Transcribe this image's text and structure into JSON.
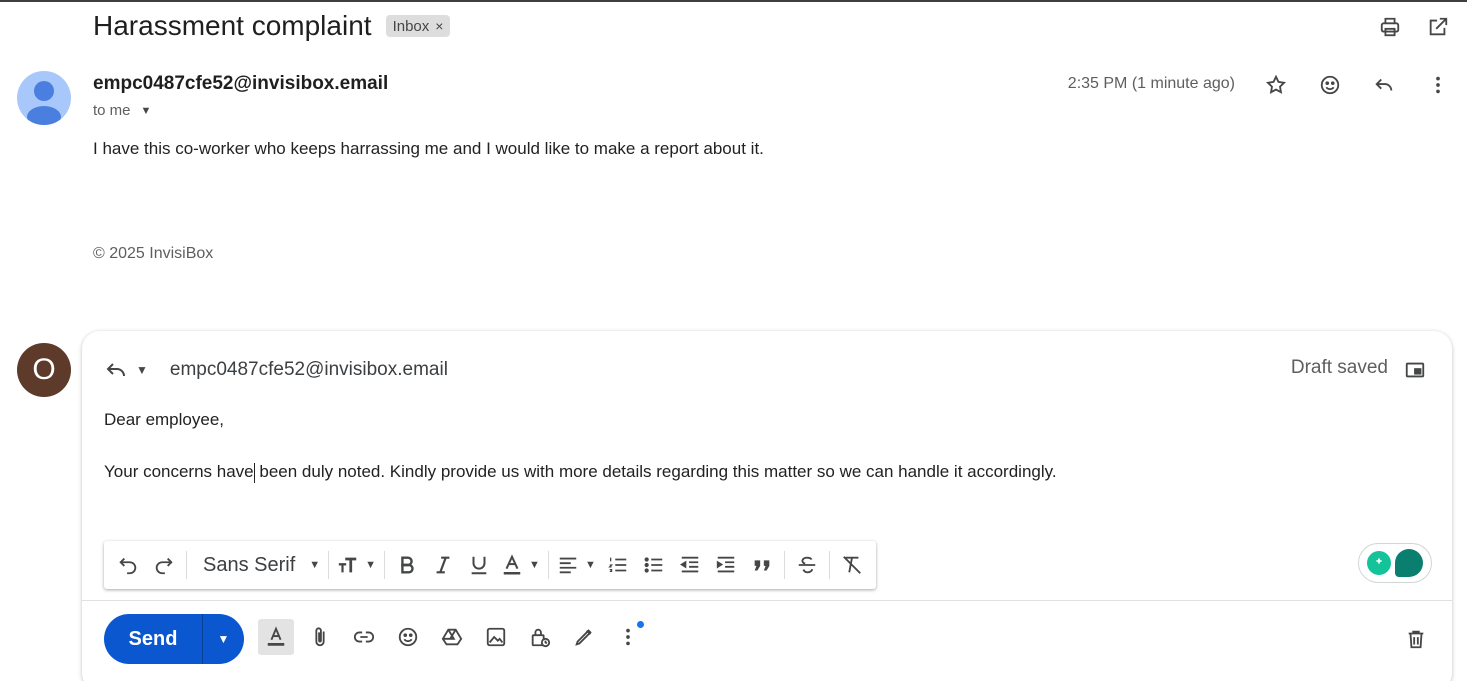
{
  "subject": {
    "title": "Harassment complaint",
    "label": "Inbox",
    "label_remove": "×"
  },
  "message": {
    "sender": "empc0487cfe52@invisibox.email",
    "to": "to me",
    "timestamp": "2:35 PM (1 minute ago)",
    "body": "I have this co-worker who keeps harrassing me and I would like to make a report about it.",
    "footer": "© 2025 InvisiBox"
  },
  "reply": {
    "avatar_letter": "O",
    "recipient": "empc0487cfe52@invisibox.email",
    "status": "Draft saved",
    "greeting": "Dear employee,",
    "body_part1": "Your concerns have",
    "body_part2": " been duly noted. Kindly provide us with more details regarding this matter so we can handle it accordingly.",
    "font": "Sans Serif",
    "send_label": "Send"
  },
  "colors": {
    "accent": "#0b57d0",
    "sender_avatar": "#a8c7fa",
    "me_avatar": "#5d3a2a",
    "grammar_green": "#15c39a"
  },
  "icons": {
    "top": [
      "print-icon",
      "open-in-new-icon"
    ],
    "message": [
      "star-icon",
      "emoji-icon",
      "reply-icon",
      "more-vert-icon"
    ],
    "format": [
      "undo-icon",
      "redo-icon",
      "text-size-icon",
      "bold-icon",
      "italic-icon",
      "underline-icon",
      "text-color-icon",
      "align-icon",
      "numbered-list-icon",
      "bulleted-list-icon",
      "indent-less-icon",
      "indent-more-icon",
      "quote-icon",
      "strikethrough-icon",
      "clear-format-icon"
    ],
    "bottom": [
      "formatting-icon",
      "attach-icon",
      "link-icon",
      "emoji-icon",
      "drive-icon",
      "photo-icon",
      "confidential-icon",
      "signature-icon",
      "more-options-icon",
      "trash-icon"
    ]
  }
}
